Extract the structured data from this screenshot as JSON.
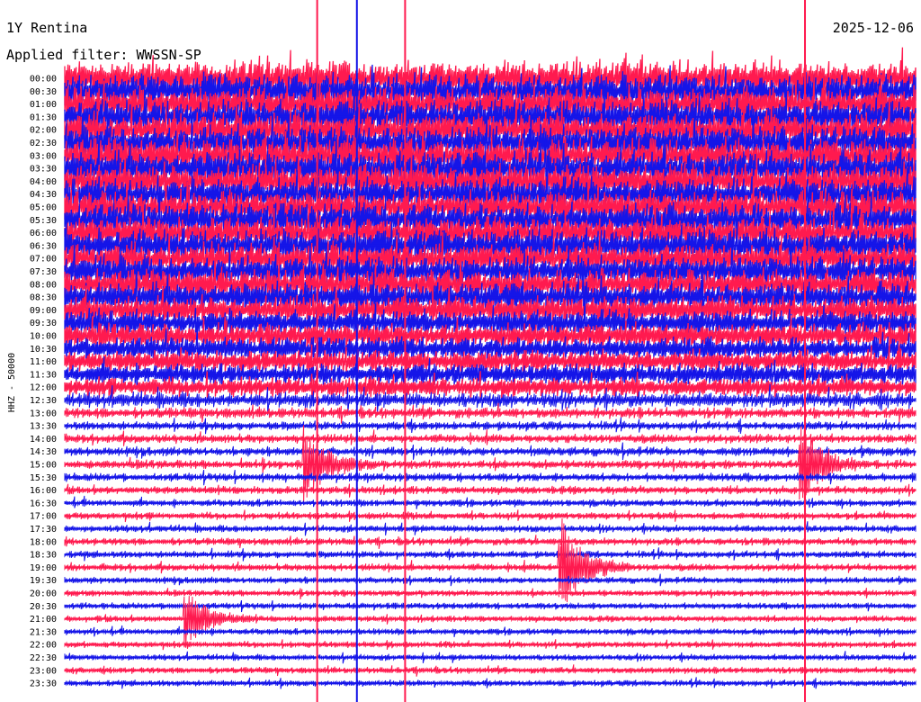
{
  "header": {
    "station": "1Y Rentina",
    "date": "2025-12-06",
    "filter": "Applied filter: WWSSN-SP"
  },
  "chart_data": {
    "type": "line",
    "title": "1Y Rentina",
    "subtitle": "Applied filter: WWSSN-SP",
    "ylabel": "HHZ - 50000",
    "xlabel": "",
    "row_labels": [
      "00:00",
      "00:30",
      "01:00",
      "01:30",
      "02:00",
      "02:30",
      "03:00",
      "03:30",
      "04:00",
      "04:30",
      "05:00",
      "05:30",
      "06:00",
      "06:30",
      "07:00",
      "07:30",
      "08:00",
      "08:30",
      "09:00",
      "09:30",
      "10:00",
      "10:30",
      "11:00",
      "11:30",
      "12:00",
      "12:30",
      "13:00",
      "13:30",
      "14:00",
      "14:30",
      "15:00",
      "15:30",
      "16:00",
      "16:30",
      "17:00",
      "17:30",
      "18:00",
      "18:30",
      "19:00",
      "19:30",
      "20:00",
      "20:30",
      "21:00",
      "21:30",
      "22:00",
      "22:30",
      "23:00",
      "23:30"
    ],
    "series_colors": [
      "#ff1a4f",
      "#1515e8"
    ],
    "row_color_pattern": "alternating",
    "x_range_minutes": [
      0,
      30
    ],
    "noise_level_by_row": [
      0.95,
      0.95,
      0.95,
      0.95,
      0.95,
      0.95,
      0.95,
      0.95,
      0.95,
      0.9,
      0.9,
      0.9,
      0.9,
      0.9,
      0.85,
      0.85,
      0.8,
      0.8,
      0.75,
      0.7,
      0.65,
      0.6,
      0.6,
      0.55,
      0.5,
      0.4,
      0.25,
      0.2,
      0.2,
      0.2,
      0.2,
      0.18,
      0.18,
      0.15,
      0.15,
      0.15,
      0.15,
      0.15,
      0.15,
      0.12,
      0.12,
      0.12,
      0.12,
      0.12,
      0.12,
      0.12,
      0.12,
      0.12
    ],
    "events": [
      {
        "minute": 8.9,
        "rows_from": 0,
        "rows_to": 48,
        "note": "spike"
      },
      {
        "minute": 10.3,
        "rows_from": 0,
        "rows_to": 48,
        "note": "spike"
      },
      {
        "minute": 12.0,
        "rows_from": 0,
        "rows_to": 48,
        "note": "spike"
      },
      {
        "minute": 26.1,
        "rows_from": 0,
        "rows_to": 48,
        "note": "spike"
      },
      {
        "minute": 8.5,
        "row": 30,
        "amplitude": 2.5
      },
      {
        "minute": 26.0,
        "row": 30,
        "amplitude": 2.5
      },
      {
        "minute": 17.5,
        "row": 38,
        "amplitude": 3.5
      },
      {
        "minute": 4.3,
        "row": 42,
        "amplitude": 2.0
      }
    ]
  }
}
